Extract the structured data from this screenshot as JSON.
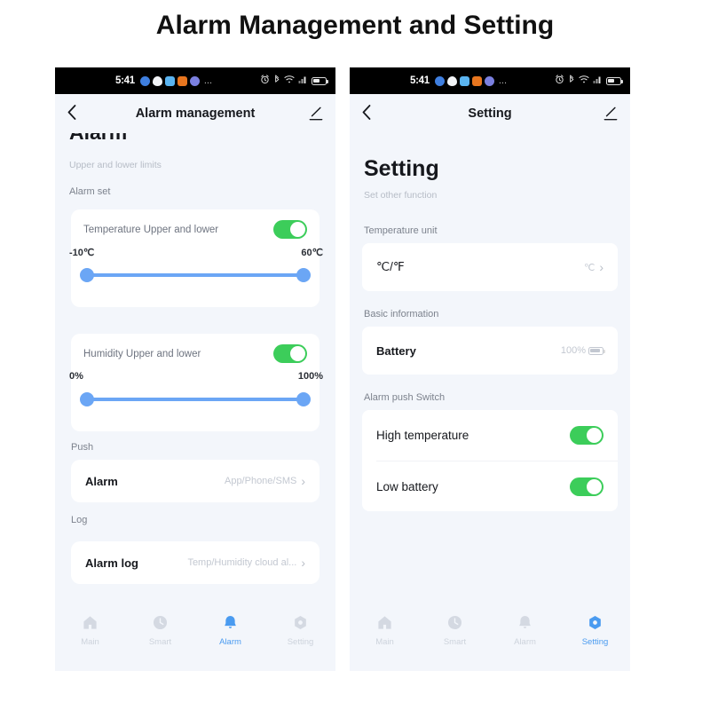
{
  "page": {
    "title": "Alarm Management and Setting"
  },
  "colors": {
    "accent_blue": "#4a9bf0",
    "slider_blue": "#6ba6f5",
    "toggle_green": "#3ccd5a",
    "screen_bg": "#f3f6fb",
    "card_bg": "#ffffff",
    "muted_text": "#b6bcc6",
    "title_text": "#16181d"
  },
  "status_bar": {
    "time": "5:41",
    "app_icons": [
      "blue-circle-icon",
      "water-drop-icon",
      "cloud-icon",
      "orange-app-icon",
      "globe-icon"
    ],
    "overflow": "...",
    "system_icons": [
      "alarm-clock-icon",
      "bluetooth-icon",
      "wifi-icon",
      "signal-bars-icon",
      "battery-icon"
    ]
  },
  "left_screen": {
    "nav": {
      "back_icon": "chevron-left-icon",
      "title": "Alarm management",
      "edit_icon": "pencil-edit-icon"
    },
    "clipped_heading": "Alarm",
    "subtitle": "Upper and lower limits",
    "section_alarm_set": "Alarm set",
    "temperature_card": {
      "label": "Temperature Upper and lower",
      "toggle_on": true,
      "lower_limit": "-10℃",
      "upper_limit": "60℃",
      "slider_min_pct": 0,
      "slider_max_pct": 100
    },
    "humidity_card": {
      "label": "Humidity Upper and lower",
      "toggle_on": true,
      "lower_limit": "0%",
      "upper_limit": "100%",
      "slider_min_pct": 0,
      "slider_max_pct": 100
    },
    "push_section": {
      "label": "Push",
      "row_title": "Alarm",
      "row_value": "App/Phone/SMS",
      "chevron": "›"
    },
    "log_section": {
      "label": "Log",
      "row_title": "Alarm log",
      "row_value": "Temp/Humidity cloud al...",
      "chevron": "›"
    },
    "tabs": [
      {
        "label": "Main",
        "icon": "home-icon",
        "active": false
      },
      {
        "label": "Smart",
        "icon": "clock-icon",
        "active": false
      },
      {
        "label": "Alarm",
        "icon": "bell-icon",
        "active": true
      },
      {
        "label": "Setting",
        "icon": "gear-icon",
        "active": false
      }
    ]
  },
  "right_screen": {
    "nav": {
      "back_icon": "chevron-left-icon",
      "title": "Setting",
      "edit_icon": "pencil-edit-icon"
    },
    "heading": "Setting",
    "subtitle": "Set other function",
    "temperature_unit_section": {
      "label": "Temperature unit",
      "row_title": "℃/℉",
      "row_value": "℃",
      "chevron": "›"
    },
    "basic_information_section": {
      "label": "Basic information",
      "row_title": "Battery",
      "row_value": "100%",
      "battery_icon": "battery-icon"
    },
    "alarm_push_section": {
      "label": "Alarm push Switch",
      "rows": [
        {
          "title": "High temperature",
          "toggle_on": true
        },
        {
          "title": "Low battery",
          "toggle_on": true
        }
      ]
    },
    "tabs": [
      {
        "label": "Main",
        "icon": "home-icon",
        "active": false
      },
      {
        "label": "Smart",
        "icon": "clock-icon",
        "active": false
      },
      {
        "label": "Alarm",
        "icon": "bell-icon",
        "active": false
      },
      {
        "label": "Setting",
        "icon": "gear-icon",
        "active": true
      }
    ]
  }
}
